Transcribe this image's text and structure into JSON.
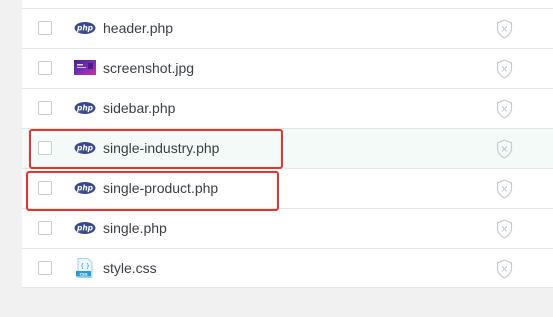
{
  "files": [
    {
      "name": "header.php",
      "type": "php",
      "icon": "php-file-icon"
    },
    {
      "name": "screenshot.jpg",
      "type": "jpg",
      "icon": "image-file-icon"
    },
    {
      "name": "sidebar.php",
      "type": "php",
      "icon": "php-file-icon"
    },
    {
      "name": "single-industry.php",
      "type": "php",
      "icon": "php-file-icon",
      "hovered": true,
      "highlighted": true
    },
    {
      "name": "single-product.php",
      "type": "php",
      "icon": "php-file-icon",
      "highlighted": true
    },
    {
      "name": "single.php",
      "type": "php",
      "icon": "php-file-icon"
    },
    {
      "name": "style.css",
      "type": "css",
      "icon": "css-file-icon"
    }
  ],
  "icon_labels": {
    "php": "php",
    "css": "css",
    "css_braces": "{ }"
  },
  "colors": {
    "php_badge": "#3b4a8f",
    "highlight": "#e3342f",
    "hover_row": "#f4faf7",
    "shield": "#c8ccd0"
  }
}
